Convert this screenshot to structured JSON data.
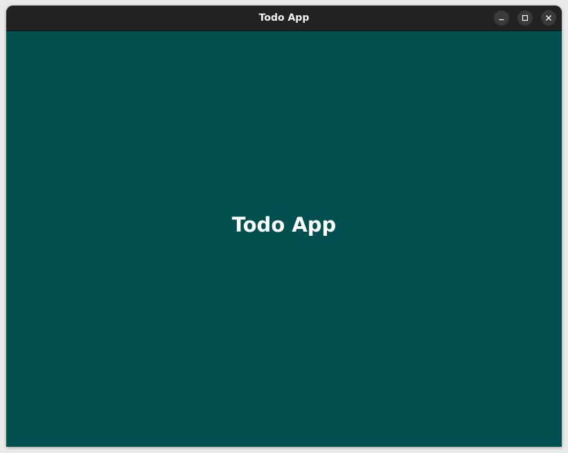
{
  "window": {
    "title": "Todo App",
    "controls": {
      "minimize_icon": "minimize-icon",
      "maximize_icon": "maximize-icon",
      "close_icon": "close-icon"
    }
  },
  "main": {
    "heading": "Todo App"
  },
  "colors": {
    "titlebar": "#222222",
    "background": "#014f4f",
    "heading_text": "#ffffff"
  }
}
